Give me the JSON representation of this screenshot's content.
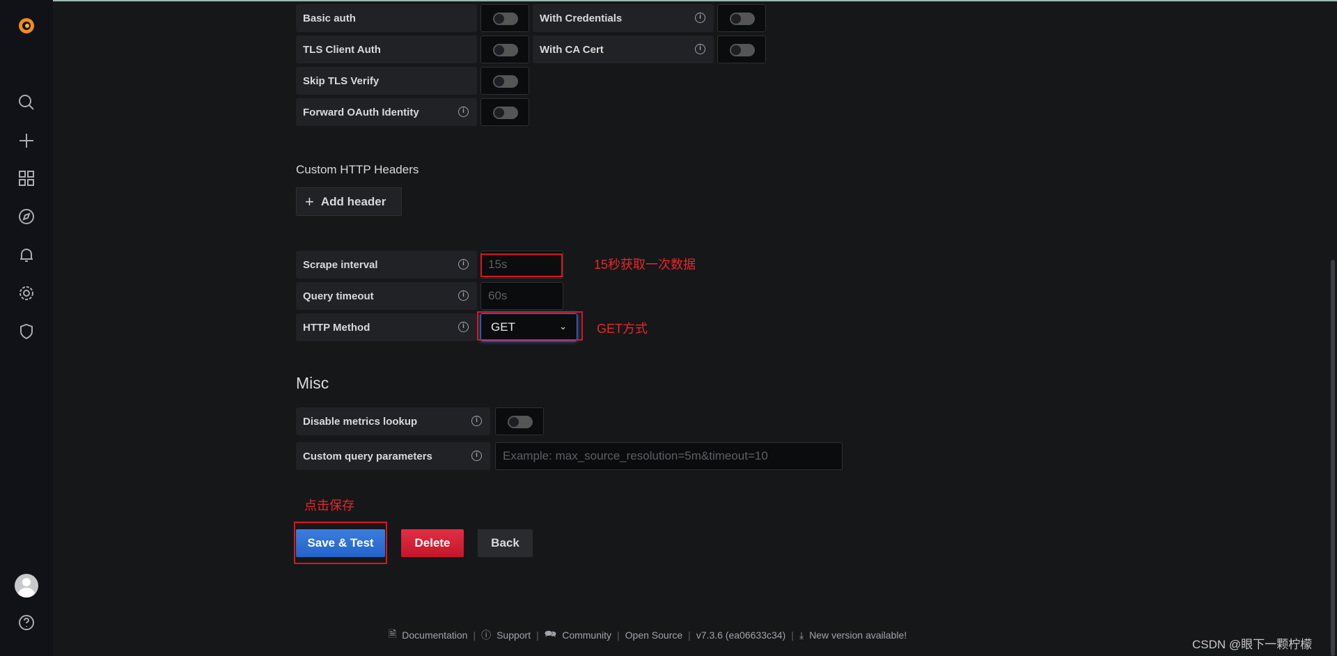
{
  "auth": {
    "rows": [
      {
        "label": "Basic auth",
        "info": false,
        "on": false
      },
      {
        "label": "TLS Client Auth",
        "info": false,
        "on": false
      },
      {
        "label": "Skip TLS Verify",
        "info": false,
        "on": false
      },
      {
        "label": "Forward OAuth Identity",
        "info": true,
        "on": false
      }
    ],
    "right_rows": [
      {
        "label": "With Credentials",
        "info": true,
        "on": false
      },
      {
        "label": "With CA Cert",
        "info": true,
        "on": false
      }
    ]
  },
  "headers": {
    "title": "Custom HTTP Headers",
    "add_label": "Add header"
  },
  "prometheus": {
    "scrape_label": "Scrape interval",
    "scrape_placeholder": "15s",
    "timeout_label": "Query timeout",
    "timeout_placeholder": "60s",
    "method_label": "HTTP Method",
    "method_value": "GET"
  },
  "misc": {
    "title": "Misc",
    "disable_label": "Disable metrics lookup",
    "disable_on": false,
    "custom_label": "Custom query parameters",
    "custom_placeholder": "Example: max_source_resolution=5m&timeout=10"
  },
  "annotations": {
    "scrape": "15秒获取一次数据",
    "method": "GET方式",
    "save": "点击保存"
  },
  "actions": {
    "save": "Save & Test",
    "delete": "Delete",
    "back": "Back"
  },
  "footer": {
    "documentation": "Documentation",
    "support": "Support",
    "community": "Community",
    "open_source": "Open Source",
    "version": "v7.3.6 (ea06633c34)",
    "new_version": "New version available!"
  },
  "watermark": "CSDN @眼下一颗柠檬",
  "colors": {
    "primary": "#3274d9",
    "danger": "#e02f44",
    "annotation": "#e0141e"
  }
}
